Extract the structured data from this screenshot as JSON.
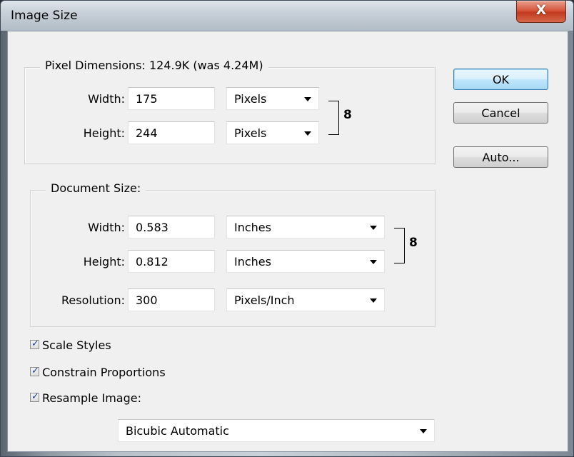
{
  "window": {
    "title": "Image Size",
    "close_glyph": "X"
  },
  "pixel_dimensions": {
    "legend": "Pixel Dimensions:  124.9K (was 4.24M)",
    "width": {
      "label": "Width:",
      "value": "175",
      "unit": "Pixels"
    },
    "height": {
      "label": "Height:",
      "value": "244",
      "unit": "Pixels"
    }
  },
  "document_size": {
    "legend": "Document Size:",
    "width": {
      "label": "Width:",
      "value": "0.583",
      "unit": "Inches"
    },
    "height": {
      "label": "Height:",
      "value": "0.812",
      "unit": "Inches"
    },
    "resolution": {
      "label": "Resolution:",
      "value": "300",
      "unit": "Pixels/Inch"
    }
  },
  "buttons": {
    "ok": "OK",
    "cancel": "Cancel",
    "auto": "Auto..."
  },
  "options": {
    "scale_styles": {
      "label": "Scale Styles",
      "checked": true
    },
    "constrain_proportions": {
      "label": "Constrain Proportions",
      "checked": true
    },
    "resample_image": {
      "label": "Resample Image:",
      "checked": true
    }
  },
  "resample_method": "Bicubic Automatic",
  "icons": {
    "chain": "chain-link-icon",
    "dropdown": "chevron-down-icon",
    "check": "checkmark-icon"
  },
  "check_glyph": "✓",
  "chain_glyph": "8",
  "colors": {
    "default_button": "#3c7fb1",
    "close_button": "#c23a20",
    "dialog_bg": "#f0f0f0"
  }
}
